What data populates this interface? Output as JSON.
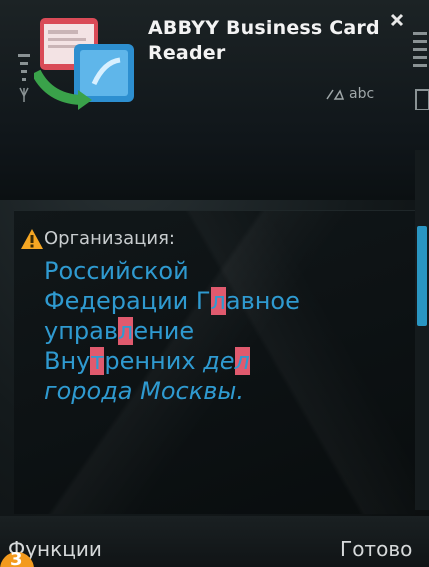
{
  "app": {
    "title": "ABBYY Business Card Reader"
  },
  "status": {
    "input_mode": "abc"
  },
  "field": {
    "label": "Организация:",
    "value_lines": [
      {
        "parts": [
          {
            "text": "Российской",
            "hl": false
          }
        ]
      },
      {
        "parts": [
          {
            "text": "Федерации Г",
            "hl": false
          },
          {
            "text": "л",
            "hl": true
          },
          {
            "text": "авное",
            "hl": false
          }
        ]
      },
      {
        "parts": [
          {
            "text": "управ",
            "hl": false
          },
          {
            "text": "л",
            "hl": true
          },
          {
            "text": "ение",
            "hl": false
          }
        ]
      },
      {
        "parts": [
          {
            "text": "Вну",
            "hl": false
          },
          {
            "text": "т",
            "hl": true
          },
          {
            "text": "ренних ",
            "hl": false
          },
          {
            "text": "де",
            "hl": false,
            "italic": true
          },
          {
            "text": "л",
            "hl": true,
            "italic": true
          }
        ]
      },
      {
        "parts": [
          {
            "text": "города Москвы.",
            "hl": false,
            "italic": true
          }
        ]
      }
    ]
  },
  "softkeys": {
    "left": "Функции",
    "right": "Готово"
  },
  "badge": {
    "step": "3"
  },
  "colors": {
    "value_text": "#2f9ad0",
    "highlight": "#e05a6e",
    "scroll_thumb": "#2a96c2",
    "warning": "#f5a623"
  }
}
